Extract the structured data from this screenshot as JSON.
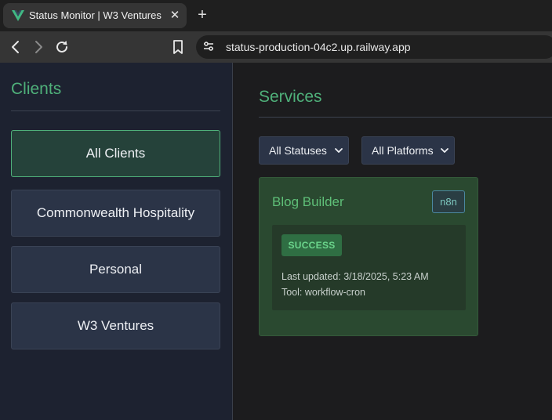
{
  "browser": {
    "tab_title": "Status Monitor | W3 Ventures",
    "tab_close": "✕",
    "new_tab": "+",
    "url": "status-production-04c2.up.railway.app"
  },
  "sidebar": {
    "title": "Clients",
    "items": [
      {
        "label": "All Clients",
        "active": true
      },
      {
        "label": "Commonwealth Hospitality",
        "active": false
      },
      {
        "label": "Personal",
        "active": false
      },
      {
        "label": "W3 Ventures",
        "active": false
      }
    ]
  },
  "main": {
    "title": "Services",
    "filters": {
      "status": "All Statuses",
      "platform": "All Platforms"
    },
    "services": [
      {
        "name": "Blog Builder",
        "platform": "n8n",
        "status": "SUCCESS",
        "last_updated": "Last updated: 3/18/2025, 5:23 AM",
        "tool": "Tool: workflow-cron"
      }
    ]
  },
  "colors": {
    "accent": "#4fb07a",
    "sidebar_bg": "#1d2230",
    "card_bg": "#2a4930",
    "success": "#6bd58c"
  }
}
